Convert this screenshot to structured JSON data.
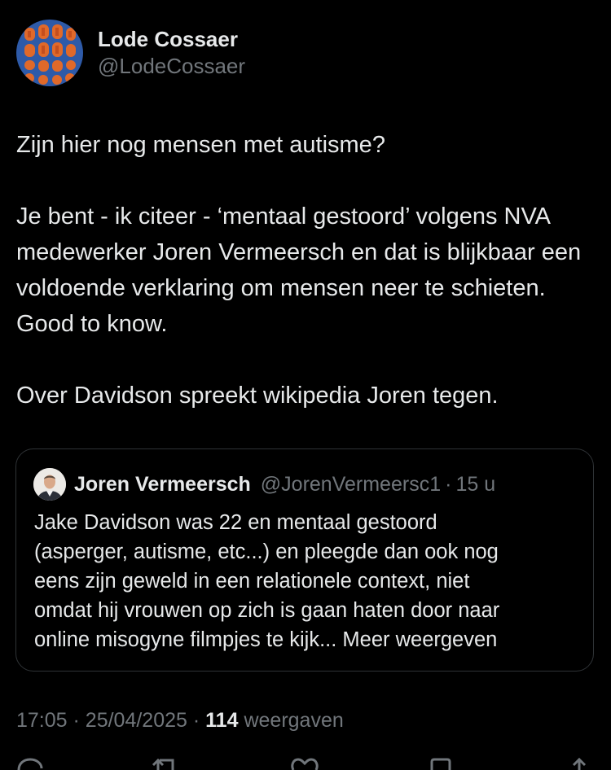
{
  "author": {
    "display_name": "Lode Cossaer",
    "handle": "@LodeCossaer"
  },
  "body": {
    "paragraphs": [
      "Zijn hier nog mensen met autisme?",
      "Je bent - ik citeer - ‘mentaal gestoord’ volgens NVA medewerker Joren Vermeersch en dat is blijkbaar een voldoende verklaring om mensen neer te schieten. Good to know.",
      "Over Davidson spreekt wikipedia Joren tegen."
    ]
  },
  "quote": {
    "display_name": "Joren Vermeersch",
    "handle": "@JorenVermeersc1",
    "separator": "·",
    "time": "15 u",
    "lines": [
      "Jake Davidson was 22 en mentaal gestoord",
      "(asperger, autisme, etc...) en pleegde dan ook nog",
      "eens zijn geweld in een relationele context, niet",
      "omdat hij vrouwen op zich is gaan haten door naar",
      "online misogyne filmpjes te kijk..."
    ],
    "show_more": "Meer weergeven"
  },
  "meta": {
    "time": "17:05",
    "separator": "·",
    "date": "25/04/2025",
    "views_count": "114",
    "views_label": "weergaven"
  },
  "colors": {
    "background": "#000000",
    "text_primary": "#e7e9ea",
    "text_secondary": "#71767b",
    "border": "#2f3336"
  },
  "icons": {
    "reply": "reply-icon",
    "repost": "repost-icon",
    "like": "heart-icon",
    "bookmark": "bookmark-icon",
    "share": "share-icon"
  }
}
